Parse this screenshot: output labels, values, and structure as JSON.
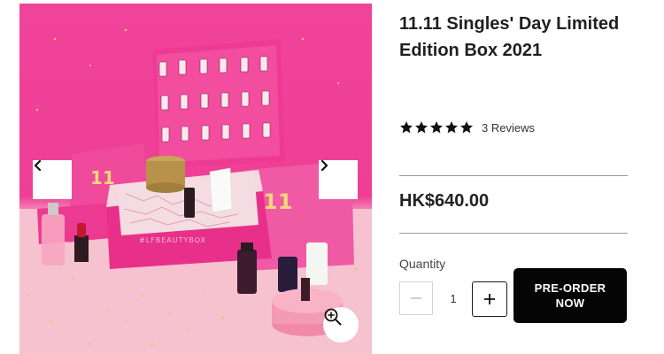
{
  "product": {
    "title": "11.11 Singles' Day Limited Edition Box 2021",
    "rating": 5,
    "reviews_text": "3 Reviews",
    "price": "HK$640.00",
    "box_print": "#LFBEAUTYBOX",
    "box_number": "11"
  },
  "quantity": {
    "label": "Quantity",
    "value": "1",
    "decrement_symbol": "−",
    "increment_symbol": "+"
  },
  "actions": {
    "preorder_label": "PRE-ORDER NOW"
  },
  "gallery": {
    "prev_icon": "chevron-left-icon",
    "next_icon": "chevron-right-icon",
    "zoom_icon": "zoom-in-icon"
  },
  "colors": {
    "background_pink": "#ef4299",
    "box_pink": "#ec2f8c",
    "floor_pink": "#f6c3cf",
    "button_black": "#050505",
    "star": "#111111"
  }
}
